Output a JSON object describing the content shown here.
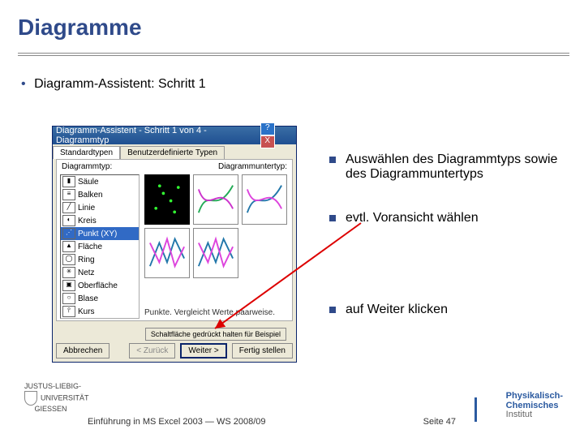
{
  "slide": {
    "title": "Diagramme",
    "bullet1": "Diagramm-Assistent: Schritt 1"
  },
  "dialog": {
    "titlebar": "Diagramm-Assistent - Schritt 1 von 4 - Diagrammtyp",
    "help_icon": "?",
    "close_icon": "X",
    "tabs": {
      "standard": "Standardtypen",
      "custom": "Benutzerdefinierte Typen"
    },
    "labels": {
      "type": "Diagrammtyp:",
      "subtype": "Diagrammuntertyp:"
    },
    "types": [
      {
        "icon": "▮",
        "name": "Säule"
      },
      {
        "icon": "≡",
        "name": "Balken"
      },
      {
        "icon": "╱",
        "name": "Linie"
      },
      {
        "icon": "◐",
        "name": "Kreis"
      },
      {
        "icon": "⋰",
        "name": "Punkt (XY)"
      },
      {
        "icon": "▲",
        "name": "Fläche"
      },
      {
        "icon": "◯",
        "name": "Ring"
      },
      {
        "icon": "✳",
        "name": "Netz"
      },
      {
        "icon": "▣",
        "name": "Oberfläche"
      },
      {
        "icon": "○",
        "name": "Blase"
      },
      {
        "icon": "⫯",
        "name": "Kurs"
      }
    ],
    "hint": "Punkte. Vergleicht Werte paarweise.",
    "preview_button": "Schaltfläche gedrückt halten für Beispiel",
    "buttons": {
      "cancel": "Abbrechen",
      "back": "< Zurück",
      "next": "Weiter >",
      "finish": "Fertig stellen"
    }
  },
  "side_notes": {
    "n1": "Auswählen des Diagrammtyps sowie des Diagrammuntertyps",
    "n2": "evtl. Voransicht wählen",
    "n3": "auf Weiter klicken"
  },
  "footer": {
    "uni_line1": "JUSTUS-LIEBIG-",
    "uni_line2": "UNIVERSITÄT",
    "uni_line3": "GIESSEN",
    "center": "Einführung in MS Excel 2003  ―  WS 2008/09",
    "page": "Seite 47",
    "inst_p": "Physikalisch-",
    "inst_c": "Chemisches",
    "inst_i": "Institut"
  },
  "chart_data": {
    "type": "scatter",
    "note": "Thumbnail chart-subtype previews shown as small schematic icons; no numeric axes or readable data values are visible in the screenshot.",
    "subtype_grid": [
      [
        "scatter-points-only",
        "scatter-smooth-lines-markers",
        "scatter-smooth-lines"
      ],
      [
        "scatter-straight-lines-markers",
        "scatter-straight-lines",
        ""
      ]
    ],
    "selected_subtype": "scatter-points-only"
  }
}
